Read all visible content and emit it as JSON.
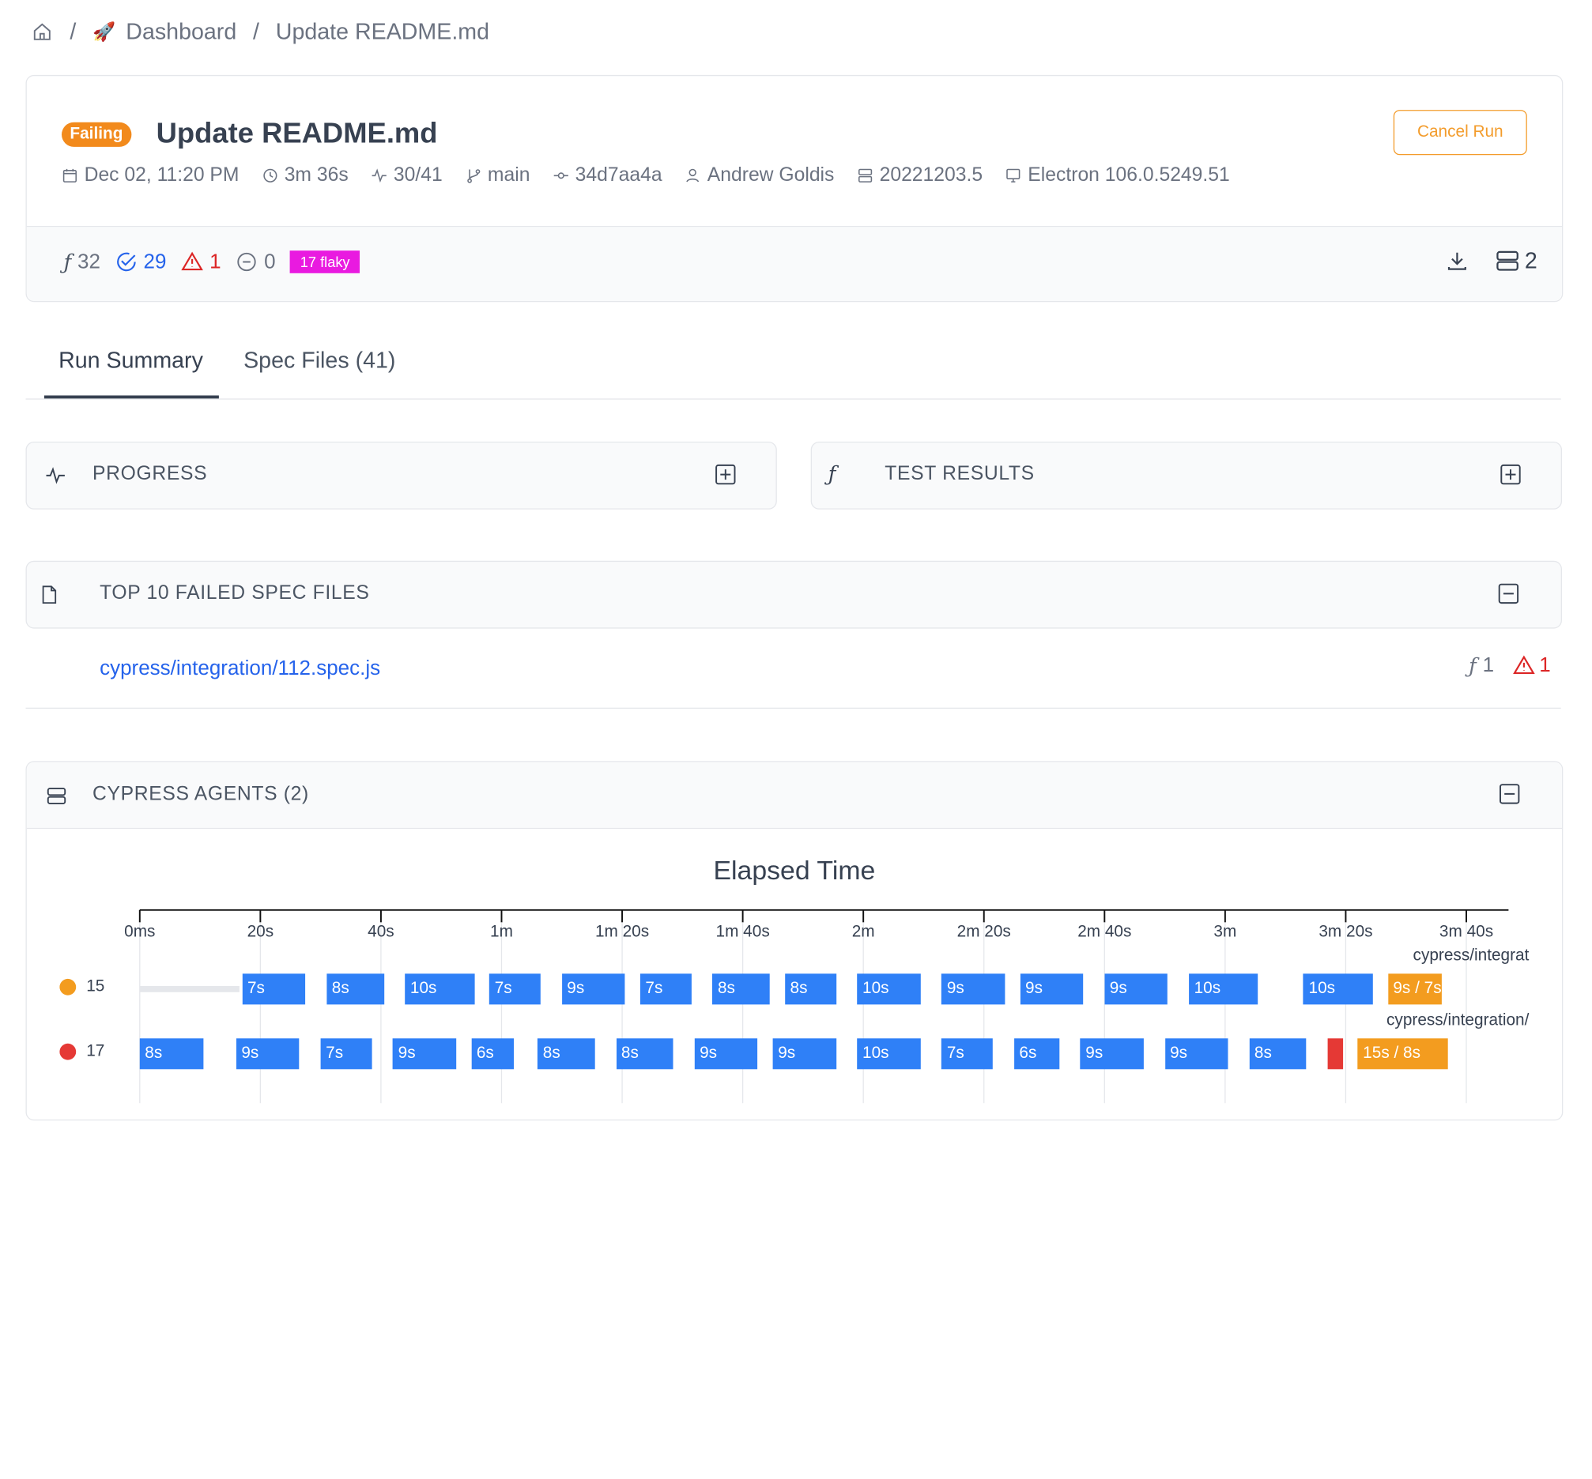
{
  "breadcrumb": {
    "dashboard": "Dashboard",
    "current": "Update README.md"
  },
  "run": {
    "status": "Failing",
    "title": "Update README.md",
    "cancel_label": "Cancel Run",
    "date": "Dec 02, 11:20 PM",
    "duration": "3m 36s",
    "progress": "30/41",
    "branch": "main",
    "commit": "34d7aa4a",
    "author": "Andrew Goldis",
    "build": "20221203.5",
    "browser": "Electron 106.0.5249.51"
  },
  "stats": {
    "tests": "32",
    "passed": "29",
    "failed": "1",
    "skipped": "0",
    "flaky": "17 flaky",
    "machines": "2"
  },
  "tabs": {
    "summary": "Run Summary",
    "specs": "Spec Files (41)"
  },
  "panels": {
    "progress": "PROGRESS",
    "test_results": "TEST RESULTS",
    "top_failed": "TOP 10 FAILED SPEC FILES",
    "agents": "CYPRESS AGENTS (2)"
  },
  "failed_spec": {
    "name": "cypress/integration/112.spec.js",
    "tests": "1",
    "failures": "1"
  },
  "colors": {
    "blue": "#2f80f7",
    "orange": "#f39c1f",
    "red": "#e53935",
    "accent": "#f28a1c",
    "flaky": "#e91ae0"
  },
  "chart_data": {
    "type": "timeline",
    "title": "Elapsed Time",
    "x_ticks": [
      "0ms",
      "20s",
      "40s",
      "1m",
      "1m 20s",
      "1m 40s",
      "2m",
      "2m 20s",
      "2m 40s",
      "3m",
      "3m 20s",
      "3m 40s"
    ],
    "xlim": [
      0,
      227
    ],
    "agents": [
      {
        "name": "15",
        "color": "#f39c1f",
        "bars": [
          {
            "start": 0,
            "end": 16.5,
            "label": "",
            "kind": "idle"
          },
          {
            "start": 17,
            "end": 27.5,
            "label": "7s",
            "kind": "pass"
          },
          {
            "start": 31,
            "end": 40.5,
            "label": "8s",
            "kind": "pass"
          },
          {
            "start": 44,
            "end": 55.5,
            "label": "10s",
            "kind": "pass"
          },
          {
            "start": 58,
            "end": 66.5,
            "label": "7s",
            "kind": "pass"
          },
          {
            "start": 70,
            "end": 80.5,
            "label": "9s",
            "kind": "pass"
          },
          {
            "start": 83,
            "end": 91.5,
            "label": "7s",
            "kind": "pass"
          },
          {
            "start": 95,
            "end": 104.5,
            "label": "8s",
            "kind": "pass"
          },
          {
            "start": 107,
            "end": 115.5,
            "label": "8s",
            "kind": "pass"
          },
          {
            "start": 119,
            "end": 129.5,
            "label": "10s",
            "kind": "pass"
          },
          {
            "start": 133,
            "end": 143.5,
            "label": "9s",
            "kind": "pass"
          },
          {
            "start": 146,
            "end": 156.5,
            "label": "9s",
            "kind": "pass"
          },
          {
            "start": 160,
            "end": 170.5,
            "label": "9s",
            "kind": "pass"
          },
          {
            "start": 174,
            "end": 185.5,
            "label": "10s",
            "kind": "pass"
          },
          {
            "start": 193,
            "end": 204.5,
            "label": "10s",
            "kind": "pass"
          },
          {
            "start": 207,
            "end": 216,
            "label": "9s / 7s",
            "kind": "flaky"
          }
        ],
        "spec_label": "cypress/integrat"
      },
      {
        "name": "17",
        "color": "#e53935",
        "bars": [
          {
            "start": 0,
            "end": 10.5,
            "label": "8s",
            "kind": "pass"
          },
          {
            "start": 16,
            "end": 26.5,
            "label": "9s",
            "kind": "pass"
          },
          {
            "start": 30,
            "end": 38.5,
            "label": "7s",
            "kind": "pass"
          },
          {
            "start": 42,
            "end": 52.5,
            "label": "9s",
            "kind": "pass"
          },
          {
            "start": 55,
            "end": 62,
            "label": "6s",
            "kind": "pass"
          },
          {
            "start": 66,
            "end": 75.5,
            "label": "8s",
            "kind": "pass"
          },
          {
            "start": 79,
            "end": 88.5,
            "label": "8s",
            "kind": "pass"
          },
          {
            "start": 92,
            "end": 102.5,
            "label": "9s",
            "kind": "pass"
          },
          {
            "start": 105,
            "end": 115.5,
            "label": "9s",
            "kind": "pass"
          },
          {
            "start": 119,
            "end": 129.5,
            "label": "10s",
            "kind": "pass"
          },
          {
            "start": 133,
            "end": 141.5,
            "label": "7s",
            "kind": "pass"
          },
          {
            "start": 145,
            "end": 152.5,
            "label": "6s",
            "kind": "pass"
          },
          {
            "start": 156,
            "end": 166.5,
            "label": "9s",
            "kind": "pass"
          },
          {
            "start": 170,
            "end": 180.5,
            "label": "9s",
            "kind": "pass"
          },
          {
            "start": 184,
            "end": 193.5,
            "label": "8s",
            "kind": "pass"
          },
          {
            "start": 197,
            "end": 199.5,
            "label": "",
            "kind": "fail"
          },
          {
            "start": 202,
            "end": 217,
            "label": "15s / 8s",
            "kind": "flaky"
          }
        ],
        "spec_label": "cypress/integration/"
      }
    ]
  }
}
